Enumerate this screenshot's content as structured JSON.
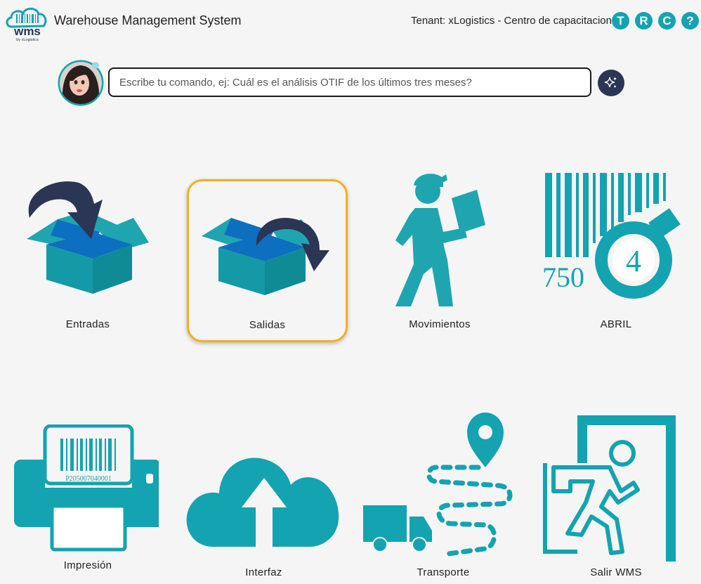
{
  "header": {
    "logo_text": "wms",
    "logo_sub": "by xLogistics",
    "title": "Warehouse Management System",
    "tenant": "Tenant: xLogistics - Centro de capacitacion",
    "buttons": [
      {
        "label": "T",
        "icon": "letter-t"
      },
      {
        "label": "R",
        "icon": "letter-r"
      },
      {
        "label": "C",
        "icon": "letter-c"
      },
      {
        "label": "?",
        "icon": "help-icon"
      }
    ]
  },
  "command": {
    "placeholder": "Escribe tu comando, ej: Cuál es el análisis OTIF de los últimos tres meses?",
    "value": ""
  },
  "tiles": [
    {
      "label": "Entradas",
      "icon": "box-in-icon",
      "selected": false
    },
    {
      "label": "Salidas",
      "icon": "box-out-icon",
      "selected": true
    },
    {
      "label": "Movimientos",
      "icon": "worker-carrying-box-icon",
      "selected": false
    },
    {
      "label": "ABRIL",
      "icon": "barcode-lot-icon",
      "selected": false,
      "icon_text_code": "750",
      "icon_text_badge": "4"
    },
    {
      "label": "Impresión",
      "icon": "barcode-printer-icon",
      "selected": false,
      "icon_text_code": "P205007040001"
    },
    {
      "label": "Interfaz",
      "icon": "cloud-upload-icon",
      "selected": false
    },
    {
      "label": "Transporte",
      "icon": "truck-route-icon",
      "selected": false
    },
    {
      "label": "Salir WMS",
      "icon": "exit-door-icon",
      "selected": false
    }
  ],
  "colors": {
    "teal": "#14a3b0",
    "teal_dark": "#0e8f9b",
    "navy": "#2b3554",
    "blue": "#1a6fc0",
    "selection": "#f2b01e",
    "background": "#f5f5f5"
  }
}
